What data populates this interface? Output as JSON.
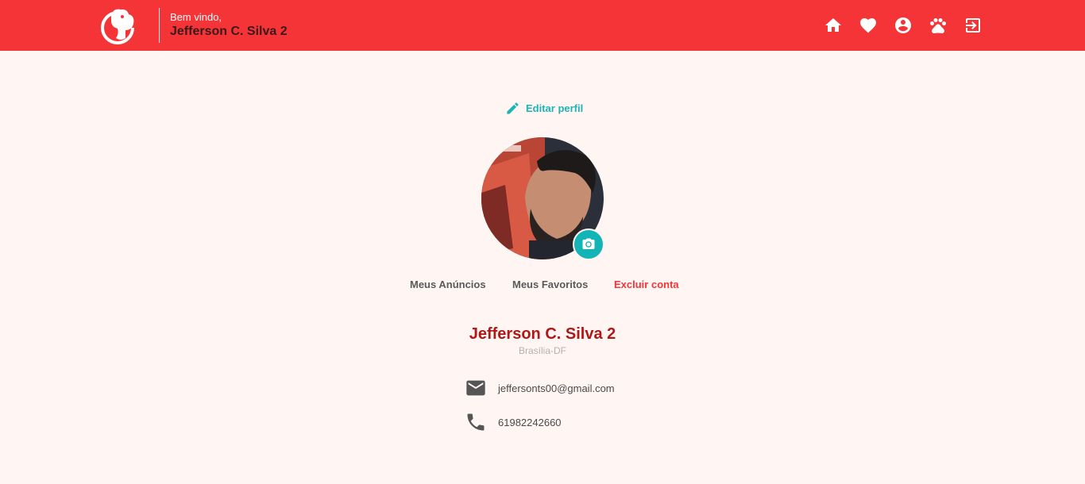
{
  "header": {
    "welcome": "Bem vindo,",
    "username": "Jefferson C. Silva 2",
    "nav_icons": [
      "home-icon",
      "heart-icon",
      "account-circle-icon",
      "paw-icon",
      "logout-icon"
    ]
  },
  "profile": {
    "edit_label": "Editar perfil",
    "tabs": [
      "Meus Anúncios",
      "Meus Favoritos",
      "Excluir conta"
    ],
    "name": "Jefferson C. Silva 2",
    "location": "Brasília-DF",
    "email": "jeffersonts00@gmail.com",
    "phone": "61982242660"
  },
  "colors": {
    "brand": "#f53438",
    "accent": "#13b4b5",
    "name": "#b01818",
    "background": "#fff6f4"
  }
}
